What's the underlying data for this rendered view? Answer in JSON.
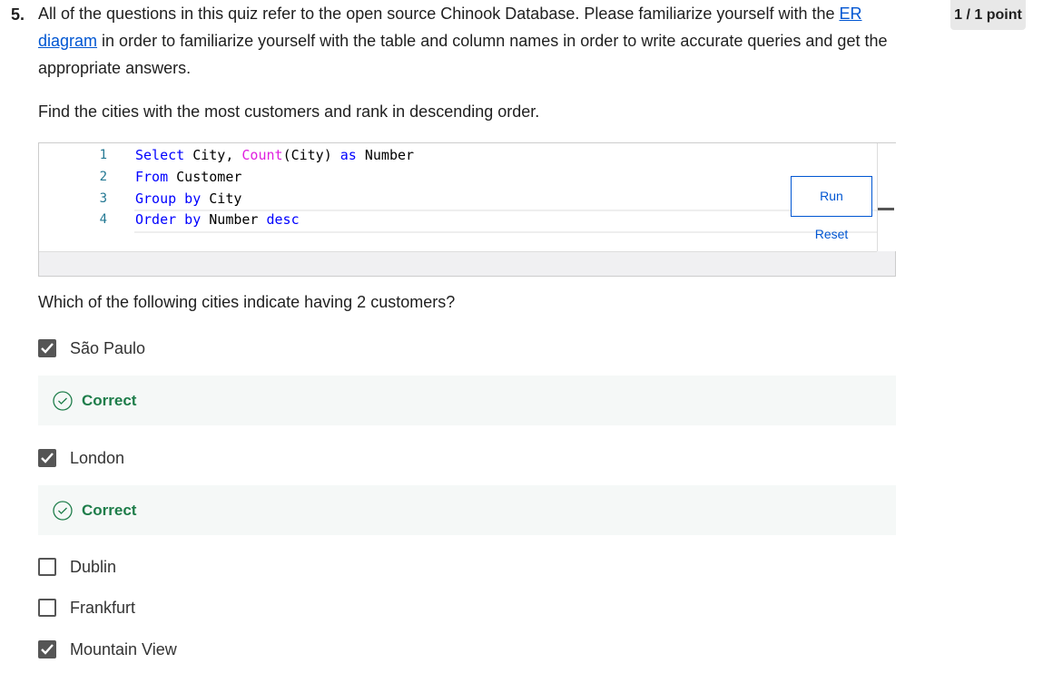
{
  "question": {
    "number": "5.",
    "text_before_link": "All of the questions in this quiz refer to the open source Chinook Database. Please familiarize yourself with the ",
    "link_text": "ER diagram",
    "text_after_link": " in order to familiarize yourself with the table and column names in order to write accurate queries and get the appropriate answers.",
    "instruction": "Find the cities with the most customers and rank in descending order.",
    "prompt": "Which of the following cities indicate having 2 customers?"
  },
  "score_badge": "1 / 1 point",
  "editor": {
    "lines": [
      {
        "n": "1",
        "tokens": [
          [
            "kw",
            "Select"
          ],
          [
            "id",
            " City, "
          ],
          [
            "fn",
            "Count"
          ],
          [
            "id",
            "(City) "
          ],
          [
            "kw",
            "as"
          ],
          [
            "id",
            " Number"
          ]
        ]
      },
      {
        "n": "2",
        "tokens": [
          [
            "kw",
            "From"
          ],
          [
            "id",
            " Customer"
          ]
        ]
      },
      {
        "n": "3",
        "tokens": [
          [
            "kw",
            "Group by"
          ],
          [
            "id",
            " City"
          ]
        ]
      },
      {
        "n": "4",
        "tokens": [
          [
            "kw",
            "Order by"
          ],
          [
            "id",
            " Number "
          ],
          [
            "kw",
            "desc"
          ]
        ]
      }
    ],
    "run_label": "Run",
    "reset_label": "Reset"
  },
  "options": [
    {
      "label": "São Paulo",
      "checked": true,
      "feedback": "Correct"
    },
    {
      "label": "London",
      "checked": true,
      "feedback": "Correct"
    },
    {
      "label": "Dublin",
      "checked": false
    },
    {
      "label": "Frankfurt",
      "checked": false
    },
    {
      "label": "Mountain View",
      "checked": true
    }
  ],
  "colors": {
    "link": "#0056d2",
    "correct": "#1e7d4a",
    "checkbox": "#555555"
  }
}
